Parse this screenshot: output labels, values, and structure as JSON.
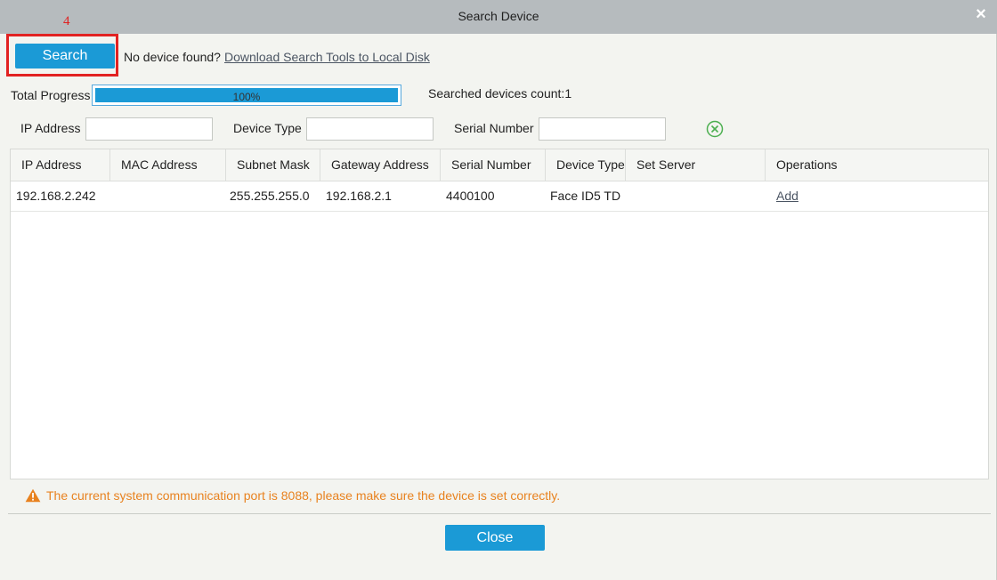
{
  "window": {
    "title": "Search Device",
    "close_glyph": "×"
  },
  "annotation": {
    "step_number": "4",
    "color": "#e22222"
  },
  "toolbar": {
    "search_label": "Search",
    "no_device_text": "No device found?",
    "download_link": "Download Search Tools to Local Disk"
  },
  "progress": {
    "label": "Total Progress",
    "value_percent": 100,
    "text": "100%",
    "count_text": "Searched devices count:1"
  },
  "filters": {
    "ip_label": "IP Address",
    "ip_value": "",
    "device_type_label": "Device Type",
    "device_type_value": "",
    "serial_label": "Serial Number",
    "serial_value": "",
    "clear_icon": "clear-circle-x-icon"
  },
  "table": {
    "columns": [
      "IP Address",
      "MAC Address",
      "Subnet Mask",
      "Gateway Address",
      "Serial Number",
      "Device Type",
      "Set Server",
      "Operations"
    ],
    "rows": [
      {
        "ip": "192.168.2.242",
        "mac": "",
        "subnet": "255.255.255.0",
        "gateway": "192.168.2.1",
        "serial": "4400100",
        "device_type": "Face ID5 TD",
        "set_server": "",
        "operation": "Add"
      }
    ]
  },
  "warning": {
    "icon": "warning-triangle-icon",
    "text": "The current system communication port is 8088, please make sure the device is set correctly.",
    "color": "#e8821f"
  },
  "footer": {
    "close_label": "Close"
  },
  "colors": {
    "accent": "#1b9ad6",
    "titlebar": "#b6bbbe",
    "background": "#f3f4f0"
  }
}
